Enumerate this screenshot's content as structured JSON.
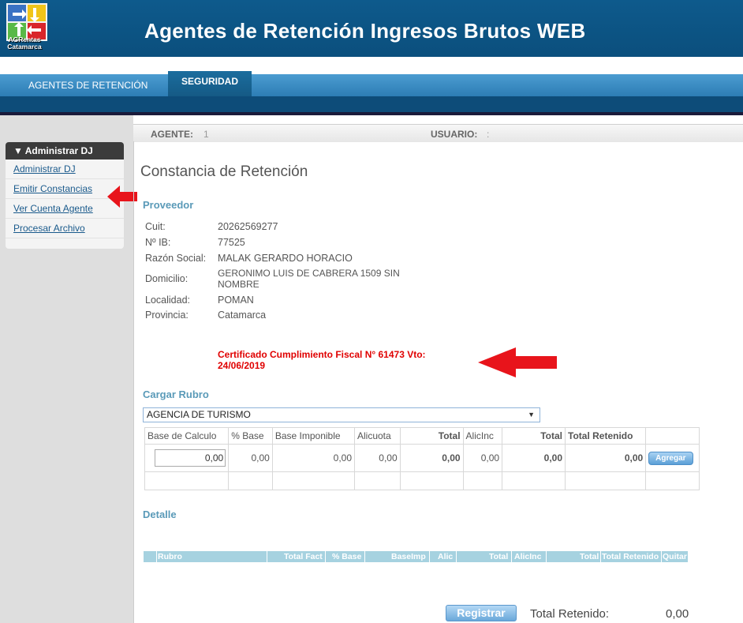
{
  "header": {
    "title": "Agentes de Retención Ingresos Brutos WEB",
    "logo_line1": "AGRentas",
    "logo_line2": "Catamarca"
  },
  "nav": {
    "items": [
      "AGENTES DE RETENCIÓN",
      "SEGURIDAD"
    ],
    "active": "SEGURIDAD"
  },
  "sidebar": {
    "title": "▼ Administrar DJ",
    "items": [
      "Administrar DJ",
      "Emitir Constancias",
      "Ver Cuenta Agente",
      "Procesar Archivo"
    ]
  },
  "agent_bar": {
    "agent_label": "AGENTE:",
    "agent_value": "1",
    "user_label": "USUARIO:",
    "user_value": ":"
  },
  "page": {
    "title": "Constancia de Retención",
    "proveedor_title": "Proveedor",
    "fields": [
      {
        "label": "Cuit:",
        "value": "20262569277"
      },
      {
        "label": "Nº IB:",
        "value": "77525"
      },
      {
        "label": "Razón Social:",
        "value": "MALAK GERARDO HORACIO"
      },
      {
        "label": "Domicilio:",
        "value": "GERONIMO LUIS DE CABRERA 1509 SIN NOMBRE"
      },
      {
        "label": "Localidad:",
        "value": "POMAN"
      },
      {
        "label": "Provincia:",
        "value": "Catamarca"
      }
    ],
    "domicilio_line1": "GERONIMO LUIS DE CABRERA 1509 SIN",
    "domicilio_line2": "NOMBRE",
    "certificado_line1": "Certificado Cumplimiento Fiscal N° 61473 Vto:",
    "certificado_line2": "24/06/2019",
    "cargar_rubro_title": "Cargar Rubro",
    "rubro_selected": "AGENCIA DE TURISMO",
    "grid_headers": [
      "Base de Calculo",
      "% Base",
      "Base Imponible",
      "Alicuota",
      "Total",
      "AlicInc",
      "Total",
      "Total Retenido"
    ],
    "grid_values": {
      "base_calculo": "0,00",
      "pct_base": "0,00",
      "base_imponible": "0,00",
      "alicuota": "0,00",
      "total": "0,00",
      "alicinc": "0,00",
      "total2": "0,00",
      "total_retenido": "0,00"
    },
    "agregar_label": "Agregar",
    "detalle_title": "Detalle",
    "detalle_headers": [
      "Rubro",
      "Total Fact",
      "% Base",
      "BaseImp",
      "Alic",
      "Total",
      "AlicInc",
      "Total",
      "Total Retenido",
      "Quitar"
    ],
    "registrar_label": "Registrar",
    "total_retenido_label": "Total Retenido:",
    "total_retenido_value": "0,00"
  },
  "colors": {
    "header_bg": "#0e5a8c",
    "nav_bg": "#3a8bc4",
    "section_title": "#5a9ab8",
    "certificado": "#e00000",
    "arrow": "#e8141b"
  }
}
